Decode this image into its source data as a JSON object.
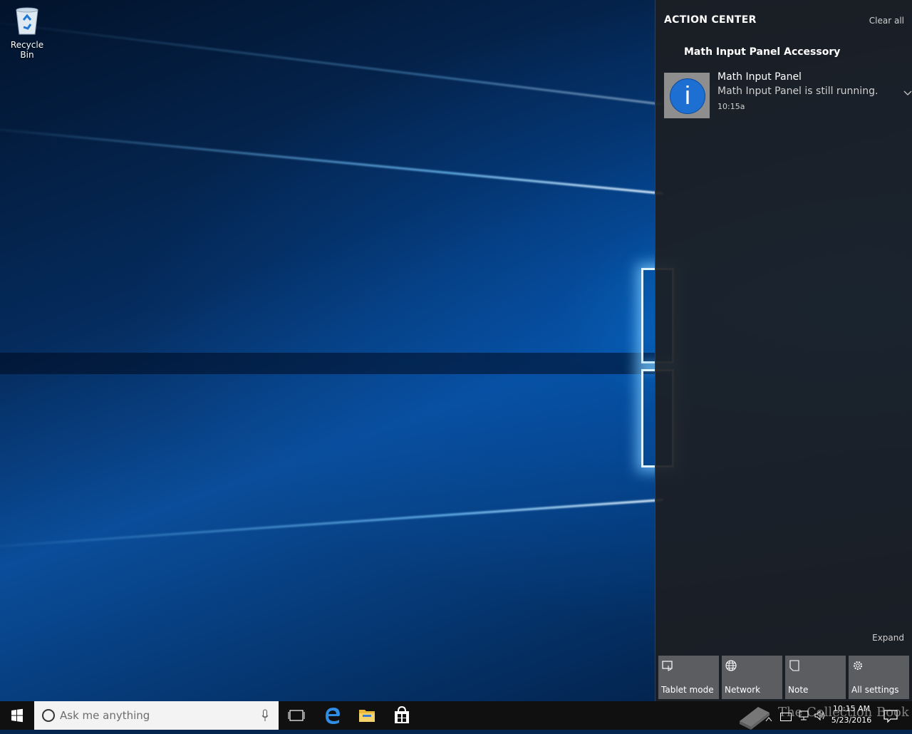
{
  "desktop": {
    "icons": [
      {
        "label": "Recycle Bin",
        "icon": "recycle-bin-icon"
      }
    ]
  },
  "action_center": {
    "title": "ACTION CENTER",
    "clear_all": "Clear all",
    "group_title": "Math Input Panel Accessory",
    "notification": {
      "title": "Math Input Panel",
      "body": "Math Input Panel is still running.",
      "time": "10:15a",
      "icon": "info-icon"
    },
    "expand_label": "Expand",
    "quick_actions": [
      {
        "label": "Tablet mode",
        "icon": "tablet-mode-icon"
      },
      {
        "label": "Network",
        "icon": "globe-icon"
      },
      {
        "label": "Note",
        "icon": "note-icon"
      },
      {
        "label": "All settings",
        "icon": "gear-icon"
      }
    ]
  },
  "taskbar": {
    "search_placeholder": "Ask me anything",
    "pinned": [
      "task-view-icon",
      "edge-icon",
      "file-explorer-icon",
      "store-icon"
    ],
    "clock": {
      "time": "10:15 AM",
      "date": "5/23/2016"
    }
  },
  "watermark": {
    "text": "The Collection Book"
  },
  "colors": {
    "wallpaper_accent": "#0a6fd6",
    "action_center_bg": "#1c1e22",
    "tile_bg": "#5b5d61",
    "info_blue": "#1d6fd1",
    "taskbar_bg": "#101010"
  }
}
